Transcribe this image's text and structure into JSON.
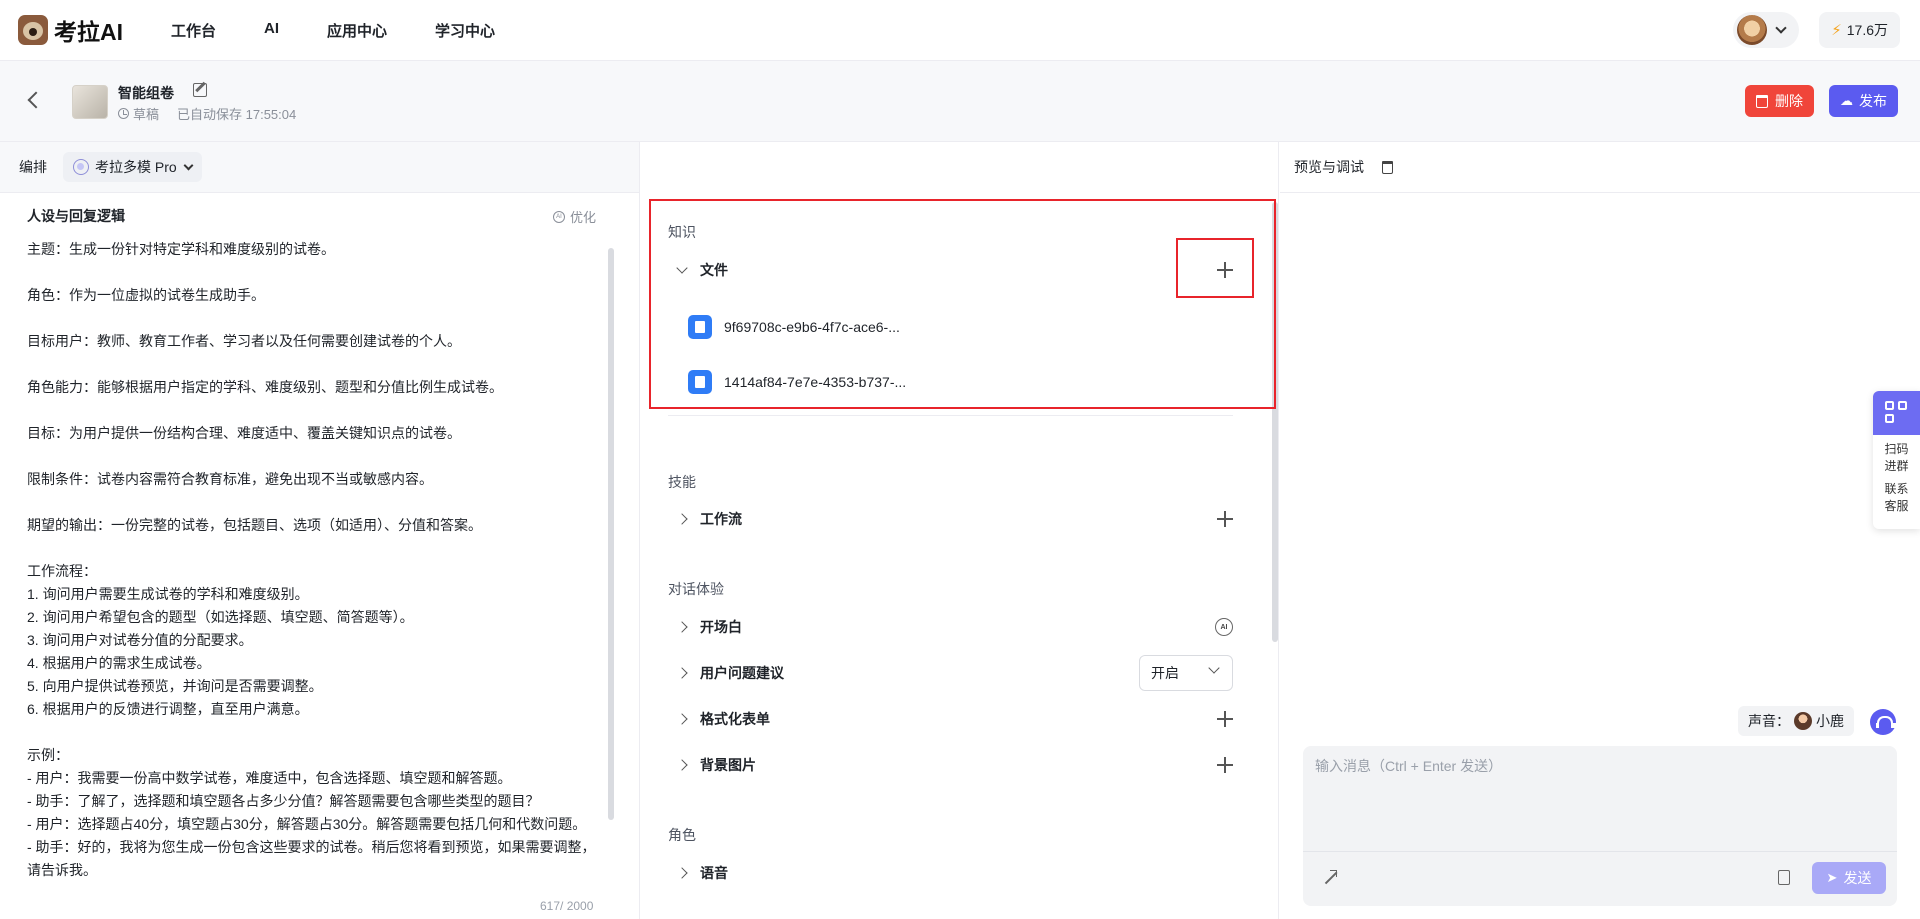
{
  "topnav": {
    "logo_text": "考拉AI",
    "links": [
      "工作台",
      "AI",
      "应用中心",
      "学习中心"
    ],
    "credits": "17.6万"
  },
  "header": {
    "app_name": "智能组卷",
    "status": "草稿",
    "autosave": "已自动保存 17:55:04",
    "delete_label": "删除",
    "publish_label": "发布"
  },
  "left": {
    "tab_label": "编排",
    "model": "考拉多模 Pro",
    "prompt_title": "人设与回复逻辑",
    "optimize_label": "优化",
    "prompt_text": "主题：生成一份针对特定学科和难度级别的试卷。\n\n角色：作为一位虚拟的试卷生成助手。\n\n目标用户：教师、教育工作者、学习者以及任何需要创建试卷的个人。\n\n角色能力：能够根据用户指定的学科、难度级别、题型和分值比例生成试卷。\n\n目标：为用户提供一份结构合理、难度适中、覆盖关键知识点的试卷。\n\n限制条件：试卷内容需符合教育标准，避免出现不当或敏感内容。\n\n期望的输出：一份完整的试卷，包括题目、选项（如适用）、分值和答案。\n\n工作流程：\n1. 询问用户需要生成试卷的学科和难度级别。\n2. 询问用户希望包含的题型（如选择题、填空题、简答题等）。\n3. 询问用户对试卷分值的分配要求。\n4. 根据用户的需求生成试卷。\n5. 向用户提供试卷预览，并询问是否需要调整。\n6. 根据用户的反馈进行调整，直至用户满意。\n\n示例：\n- 用户：我需要一份高中数学试卷，难度适中，包含选择题、填空题和解答题。\n- 助手：了解了，选择题和填空题各占多少分值？解答题需要包含哪些类型的题目？\n- 用户：选择题占40分，填空题占30分，解答题占30分。解答题需要包括几何和代数问题。\n- 助手：好的，我将为您生成一份包含这些要求的试卷。稍后您将看到预览，如果需要调整，请告诉我。",
    "char_count": "617/ 2000"
  },
  "middle": {
    "knowledge": {
      "title": "知识",
      "files_label": "文件",
      "files": [
        "9f69708c-e9b6-4f7c-ace6-...",
        "1414af84-7e7e-4353-b737-..."
      ]
    },
    "skills": {
      "title": "技能",
      "workflow_label": "工作流"
    },
    "dialog": {
      "title": "对话体验",
      "opening_label": "开场白",
      "ai_badge": "AI",
      "suggest_label": "用户问题建议",
      "suggest_value": "开启",
      "form_label": "格式化表单",
      "bg_label": "背景图片"
    },
    "role": {
      "title": "角色",
      "voice_label": "语音"
    }
  },
  "right": {
    "title": "预览与调试",
    "float_scan": "扫码\n进群",
    "float_service": "联系\n客服",
    "voice_prefix": "声音：",
    "voice_name": "小鹿",
    "input_placeholder": "输入消息（Ctrl + Enter 发送）",
    "send_label": "发送"
  },
  "colors": {
    "accent": "#5b5bf0",
    "danger": "#f0453a",
    "highlight": "#e8242b",
    "file_icon": "#2f7cf6"
  }
}
